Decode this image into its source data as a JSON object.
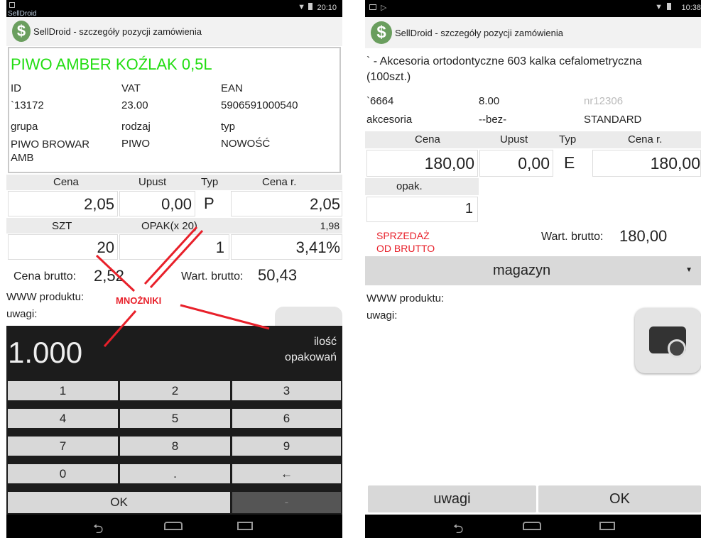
{
  "left": {
    "status": {
      "time": "20:10",
      "app_label": "SellDroid"
    },
    "title": "SellDroid - szczegóły pozycji zamówienia",
    "product": {
      "name": "PIWO AMBER KOŹLAK 0,5L",
      "id_label": "ID",
      "id_value": "`13172",
      "vat_label": "VAT",
      "vat_value": "23.00",
      "ean_label": "EAN",
      "ean_value": "5906591000540",
      "grupa_label": "grupa",
      "grupa_value": "PIWO BROWAR AMB",
      "rodzaj_label": "rodzaj",
      "rodzaj_value": "PIWO",
      "typ_label": "typ",
      "typ_value": "NOWOŚĆ"
    },
    "price": {
      "cena_h": "Cena",
      "upust_h": "Upust",
      "typ_h": "Typ",
      "cenar_h": "Cena r.",
      "cena": "2,05",
      "upust": "0,00",
      "typ": "P",
      "cenar": "2,05"
    },
    "qty": {
      "szt_h": "SZT",
      "opak_h": "OPAK(x 20)",
      "right_h": "1,98",
      "szt": "20",
      "opak": "1",
      "right": "3,41%"
    },
    "brutto_label": "Cena brutto:",
    "brutto_value": "2,52",
    "wart_label": "Wart. brutto:",
    "wart_value": "50,43",
    "www_label": "WWW produktu:",
    "uwagi_label": "uwagi:",
    "annot_mnozniki": "MNOŻNIKI",
    "annot_ilosc_1": "ilość",
    "annot_ilosc_2": "opakowań",
    "keypad": {
      "display": "1.000",
      "keys": [
        "1",
        "2",
        "3",
        "4",
        "5",
        "6",
        "7",
        "8",
        "9",
        "0",
        ".",
        "←"
      ],
      "ok": "OK",
      "dash": "-"
    }
  },
  "right": {
    "status": {
      "time": "10:38"
    },
    "title": "SellDroid - szczegóły pozycji zamówienia",
    "product": {
      "name_1": "` - Akcesoria ortodontyczne 603 kalka cefalometryczna",
      "name_2": "(100szt.)",
      "id_value": "`6664",
      "vat_value": "8.00",
      "nr_value": "nr12306",
      "grupa_value": "akcesoria",
      "rodzaj_value": "--bez-",
      "typ_value": "STANDARD"
    },
    "price": {
      "cena_h": "Cena",
      "upust_h": "Upust",
      "typ_h": "Typ",
      "cenar_h": "Cena r.",
      "cena": "180,00",
      "upust": "0,00",
      "typ": "E",
      "cenar": "180,00",
      "opak_h": "opak.",
      "opak": "1"
    },
    "sprzedaz_1": "SPRZEDAŻ",
    "sprzedaz_2": "OD BRUTTO",
    "wart_label": "Wart. brutto:",
    "wart_value": "180,00",
    "magazyn": "magazyn",
    "www_label": "WWW produktu:",
    "uwagi_label": "uwagi:",
    "btn_uwagi": "uwagi",
    "btn_ok": "OK"
  },
  "colors": {
    "accent_green": "#22dd11",
    "annot_red": "#e8202a",
    "keypad_bg": "#1c1c1c"
  }
}
